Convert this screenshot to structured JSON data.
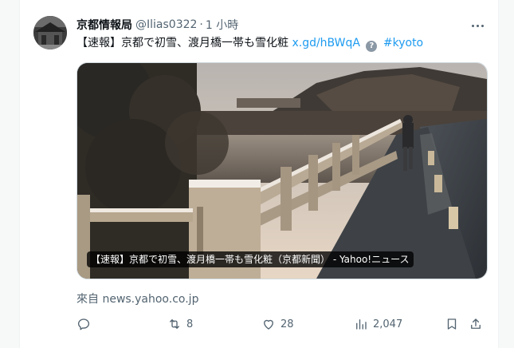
{
  "author": {
    "name": "京都情報局",
    "handle": "@Ilias0322",
    "separator": "·",
    "time": "1 小時"
  },
  "tweet": {
    "text": "【速報】京都で初雪、渡月橋一帯も雪化粧",
    "link": "x.gd/hBWqA",
    "hashtag": "#kyoto"
  },
  "media": {
    "caption": "【速報】京都で初雪、渡月橋一帯も雪化粧（京都新聞） - Yahoo!ニュース"
  },
  "source": {
    "prefix": "來自",
    "domain": "news.yahoo.co.jp"
  },
  "actions": {
    "reply_icon": "reply-icon",
    "retweet_count": "8",
    "like_count": "28",
    "views_count": "2,047",
    "bookmark_icon": "bookmark-icon",
    "share_icon": "share-icon"
  },
  "colors": {
    "accent": "#1d9bf0",
    "muted": "#536471"
  }
}
